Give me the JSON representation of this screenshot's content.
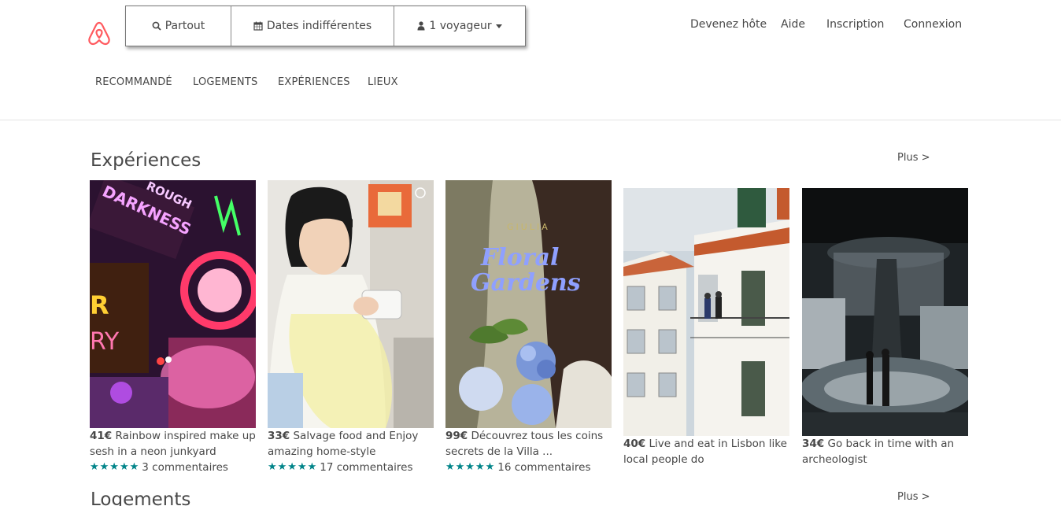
{
  "search": {
    "location_label": "Partout",
    "dates_label": "Dates indifférentes",
    "guests_label": "1 voyageur"
  },
  "topnav": {
    "host": "Devenez hôte",
    "help": "Aide",
    "signup": "Inscription",
    "login": "Connexion"
  },
  "tabs": [
    "RECOMMANDÉ",
    "LOGEMENTS",
    "EXPÉRIENCES",
    "LIEUX"
  ],
  "experiences": {
    "title": "Expériences",
    "more": "Plus >",
    "cards": [
      {
        "price": "41€",
        "title": "Rainbow inspired make up sesh in a neon junkyard",
        "stars": "★★★★★",
        "reviews": "3 commentaires"
      },
      {
        "price": "33€",
        "title": "Salvage food and Enjoy amazing home-style",
        "stars": "★★★★★",
        "reviews": "17 commentaires"
      },
      {
        "price": "99€",
        "title": "Découvrez tous les coins secrets de la Villa ...",
        "stars": "★★★★★",
        "reviews": "16 commentaires"
      },
      {
        "price": "40€",
        "title": "Live and eat in Lisbon like local people do"
      },
      {
        "price": "34€",
        "title": "Go back in time with an archeologist"
      }
    ]
  },
  "logements": {
    "title": "Logements",
    "more": "Plus >"
  },
  "images": {
    "card3_script_top": "GIULIA",
    "card3_script_line1": "Floral",
    "card3_script_line2": "Gardens"
  },
  "colors": {
    "brand": "#FF5A5F",
    "star": "#008489",
    "text": "#484848"
  }
}
